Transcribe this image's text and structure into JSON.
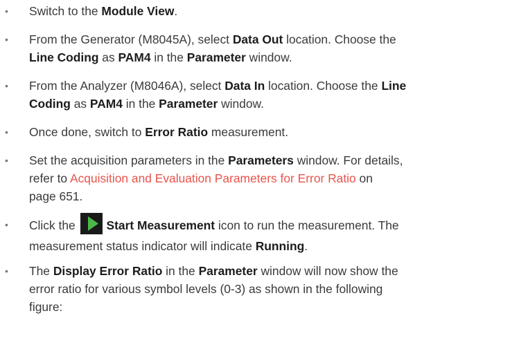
{
  "steps": [
    {
      "bullet": "•",
      "lines": [
        [
          {
            "t": "Switch to the "
          },
          {
            "t": "Module View",
            "b": true
          },
          {
            "t": "."
          }
        ]
      ]
    },
    {
      "bullet": "•",
      "lines": [
        [
          {
            "t": "From the Generator (M8045A), select "
          },
          {
            "t": "Data Out",
            "b": true
          },
          {
            "t": " location. Choose the"
          }
        ],
        [
          {
            "t": "Line Coding",
            "b": true
          },
          {
            "t": " as "
          },
          {
            "t": "PAM4",
            "b": true
          },
          {
            "t": " in the "
          },
          {
            "t": "Parameter",
            "b": true
          },
          {
            "t": " window."
          }
        ]
      ]
    },
    {
      "bullet": "•",
      "lines": [
        [
          {
            "t": "From the Analyzer (M8046A), select "
          },
          {
            "t": "Data In",
            "b": true
          },
          {
            "t": " location. Choose the "
          },
          {
            "t": "Line",
            "b": true
          }
        ],
        [
          {
            "t": "Coding",
            "b": true
          },
          {
            "t": " as "
          },
          {
            "t": "PAM4",
            "b": true
          },
          {
            "t": " in the "
          },
          {
            "t": "Parameter",
            "b": true
          },
          {
            "t": " window."
          }
        ]
      ]
    },
    {
      "bullet": "•",
      "lines": [
        [
          {
            "t": "Once done, switch to "
          },
          {
            "t": "Error Ratio",
            "b": true
          },
          {
            "t": " measurement."
          }
        ]
      ]
    },
    {
      "bullet": "•",
      "lines": [
        [
          {
            "t": "Set the acquisition parameters in the "
          },
          {
            "t": "Parameters",
            "b": true
          },
          {
            "t": " window. For details,"
          }
        ],
        [
          {
            "t": "refer to "
          },
          {
            "t": "Acquisition and Evaluation Parameters for Error Ratio",
            "link": true
          },
          {
            "t": " on"
          }
        ],
        [
          {
            "t": "page 651."
          }
        ]
      ]
    },
    {
      "bullet": "•",
      "lines": [
        [
          {
            "t": "Click the "
          },
          {
            "icon": "start-measurement-icon"
          },
          {
            "t": "Start Measurement",
            "b": true
          },
          {
            "t": " icon to run the measurement. The"
          }
        ],
        [
          {
            "t": "measurement status indicator will indicate "
          },
          {
            "t": "Running",
            "b": true
          },
          {
            "t": "."
          }
        ]
      ]
    },
    {
      "bullet": "•",
      "lines": [
        [
          {
            "t": "The "
          },
          {
            "t": "Display Error Ratio",
            "b": true
          },
          {
            "t": " in the "
          },
          {
            "t": "Parameter",
            "b": true
          },
          {
            "t": " window will now show the"
          }
        ],
        [
          {
            "t": "error ratio for various symbol levels (0-3) as shown in the following"
          }
        ],
        [
          {
            "t": "figure:"
          }
        ]
      ]
    }
  ],
  "colors": {
    "link": "#e8534b",
    "icon_background": "#1a1a1a",
    "icon_play": "#4cb848"
  }
}
